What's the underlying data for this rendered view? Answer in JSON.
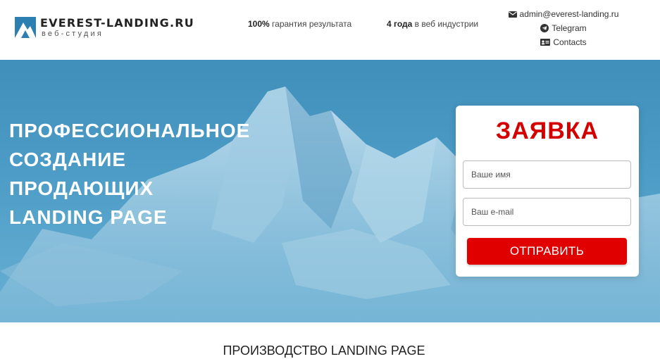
{
  "header": {
    "logo": {
      "name": "EVEREST-LANDING.RU",
      "subtitle": "веб-студия"
    },
    "usp": [
      {
        "bold": "100%",
        "text": "гарантия результата"
      },
      {
        "bold": "4 года",
        "text": "в веб индустрии"
      }
    ],
    "contacts": {
      "email": "admin@everest-landing.ru",
      "telegram": "Telegram",
      "contacts": "Contacts"
    }
  },
  "hero": {
    "title_lines": [
      "ПРОФЕССИОНАЛЬНОЕ",
      "СОЗДАНИЕ",
      "ПРОДАЮЩИХ",
      "LANDING PAGE"
    ]
  },
  "form": {
    "title": "ЗАЯВКА",
    "name_placeholder": "Ваше имя",
    "email_placeholder": "Ваш e-mail",
    "submit_label": "ОТПРАВИТЬ"
  },
  "section": {
    "title": "ПРОИЗВОДСТВО LANDING PAGE"
  },
  "colors": {
    "accent": "#e00000",
    "title_red": "#d40000",
    "hero_blue": "#4b9bc6"
  }
}
